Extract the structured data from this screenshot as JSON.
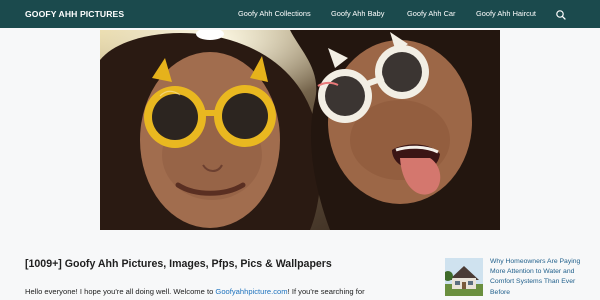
{
  "site": {
    "title": "GOOFY AHH PICTURES"
  },
  "nav": {
    "items": [
      {
        "label": "Goofy Ahh Collections"
      },
      {
        "label": "Goofy Ahh Baby"
      },
      {
        "label": "Goofy Ahh Car"
      },
      {
        "label": "Goofy Ahh Haircut"
      }
    ],
    "search_icon": "search-icon"
  },
  "colors": {
    "header_bg": "#1b4a4d",
    "link": "#1e73be",
    "page_bg": "#f7f8f9"
  },
  "article": {
    "title": "[1009+] Goofy Ahh Pictures, Images, Pfps, Pics & Wallpapers",
    "intro_start": "Hello everyone! I hope you're all doing well. Welcome to ",
    "intro_link": "Goofyahhpicture.com",
    "intro_end": "! If you're searching for"
  },
  "sidebar": {
    "post_title": "Why Homeowners Are Paying More Attention to Water and Comfort Systems Than Ever Before"
  }
}
